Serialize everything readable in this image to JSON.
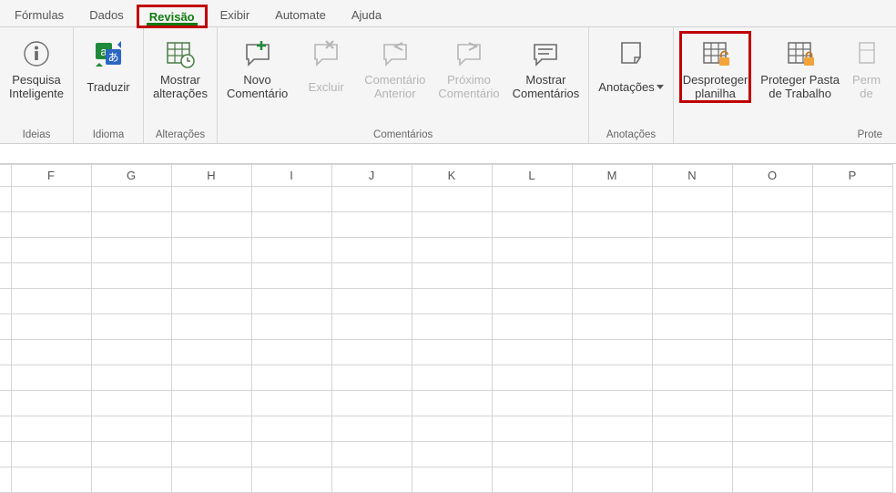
{
  "tabs": {
    "formulas": "Fórmulas",
    "dados": "Dados",
    "revisao": "Revisão",
    "exibir": "Exibir",
    "automate": "Automate",
    "ajuda": "Ajuda"
  },
  "groups": {
    "ideias": {
      "label": "Ideias",
      "pesquisa": "Pesquisa\nInteligente"
    },
    "idioma": {
      "label": "Idioma",
      "traduzir": "Traduzir"
    },
    "alteracoes": {
      "label": "Alterações",
      "mostrar": "Mostrar\nalterações"
    },
    "comentarios": {
      "label": "Comentários",
      "novo": "Novo\nComentário",
      "excluir": "Excluir",
      "anterior": "Comentário\nAnterior",
      "proximo": "Próximo\nComentário",
      "mostrar": "Mostrar\nComentários"
    },
    "anotacoes": {
      "label": "Anotações",
      "anotacoes": "Anotações"
    },
    "proteger": {
      "label": "Prote",
      "desproteger": "Desproteger\nplanilha",
      "pasta": "Proteger Pasta\nde Trabalho",
      "permitir": "Perm\nde"
    }
  },
  "columns": [
    "F",
    "G",
    "H",
    "I",
    "J",
    "K",
    "L",
    "M",
    "N",
    "O",
    "P"
  ]
}
